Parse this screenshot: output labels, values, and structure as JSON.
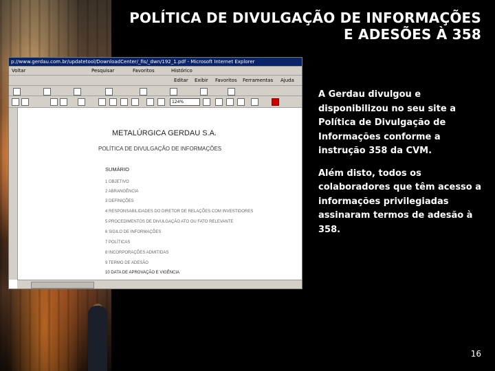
{
  "title": {
    "line1": "POLÍTICA DE DIVULGAÇÃO DE INFORMAÇÕES",
    "line2": "E ADESÕES À 358"
  },
  "browser": {
    "address": "p://www.gerdau.com.br/updatetool/DownloadCenter/_fis/_dwn/192_1.pdf - Microsoft Internet Explorer",
    "menu": [
      "Voltar",
      "Pesquisar",
      "Favoritos",
      "Histórico"
    ],
    "links": [
      "Editar",
      "Exibir",
      "Favoritos",
      "Ferramentas",
      "Ajuda"
    ],
    "zoom": "124%"
  },
  "document": {
    "heading": "METALÚRGICA GERDAU S.A.",
    "subheading": "POLÍTICA DE DIVULGAÇÃO DE INFORMAÇÕES",
    "summary_title": "SUMÁRIO",
    "items": [
      "1 OBJETIVO",
      "2 ABRANGÊNCIA",
      "3 DEFINIÇÕES",
      "4 RESPONSABILIDADES DO DIRETOR DE RELAÇÕES COM INVESTIDORES",
      "5 PROCEDIMENTOS DE DIVULGAÇÃO ATO OU FATO RELEVANTE",
      "6 SIGILO DE INFORMAÇÕES",
      "7 POLÍTICAS",
      "8 INCORPORAÇÕES ADMITIDAS",
      "9 TERMO DE ADESÃO",
      "10 DATA DE APROVAÇÃO E VIGÊNCIA"
    ]
  },
  "info": {
    "para1": "A Gerdau divulgou e disponibilizou no seu site a Política de Divulgação de Informações conforme a instrução 358  da CVM.",
    "para2": "Além disto, todos os colaboradores que têm acesso a informações privilegiadas assinaram termos de adesão à 358."
  },
  "page_number": "16"
}
